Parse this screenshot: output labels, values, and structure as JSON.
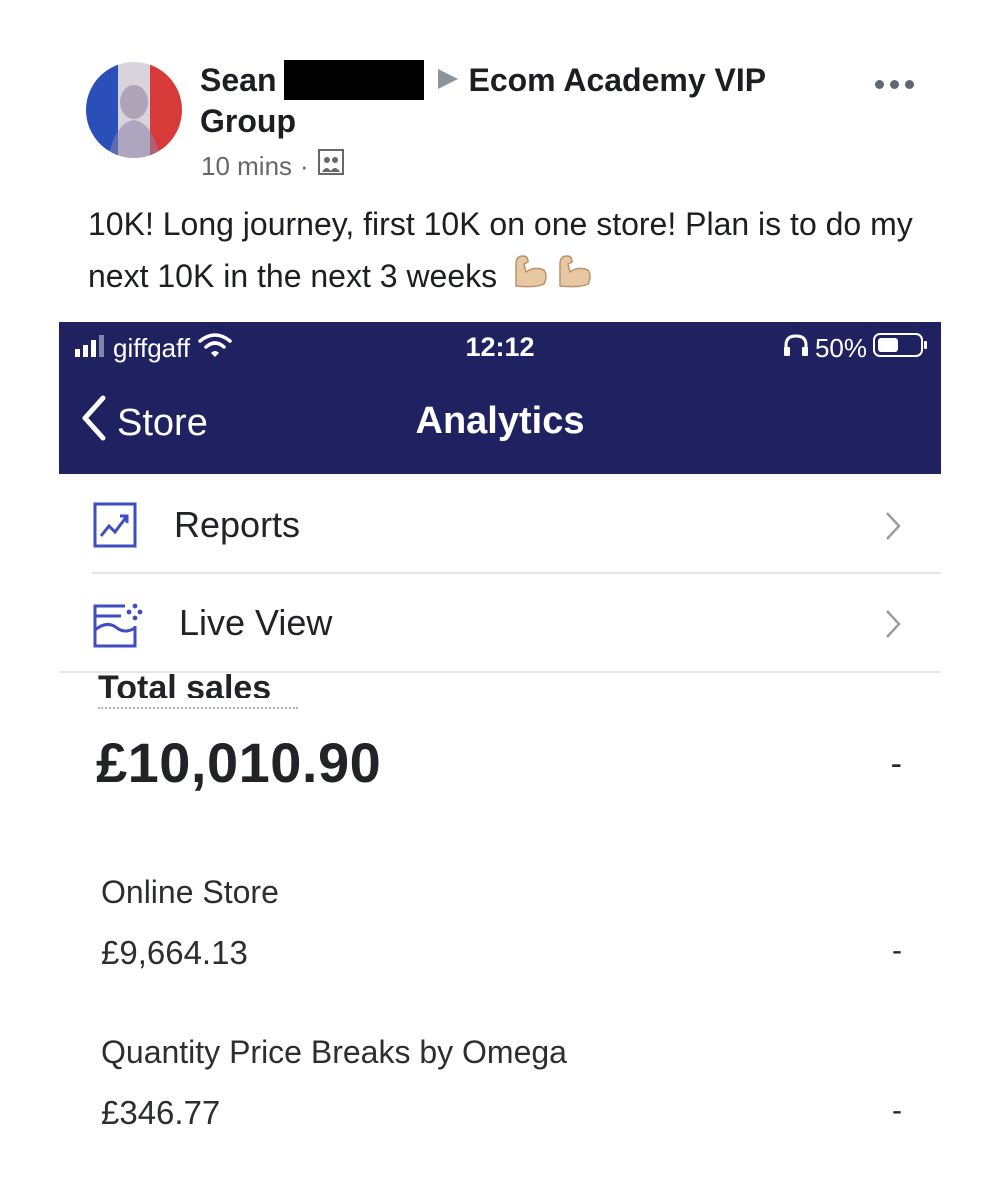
{
  "post": {
    "author_first": "Sean",
    "group_name_part1": "Ecom Academy VIP",
    "group_name_part2": "Group",
    "time": "10 mins",
    "separator": "·",
    "text": "10K! Long journey, first 10K on one store! Plan is to do my next 10K in the next 3 weeks"
  },
  "phone": {
    "status_bar": {
      "carrier": "giffgaff",
      "time": "12:12",
      "battery": "50%"
    },
    "nav": {
      "back_label": "Store",
      "title": "Analytics"
    },
    "menu": [
      {
        "label": "Reports",
        "icon": "reports-chart-icon"
      },
      {
        "label": "Live View",
        "icon": "live-view-icon"
      }
    ],
    "total_sales": {
      "label": "Total sales",
      "value": "£10,010.90",
      "change": "-"
    },
    "breakdown": [
      {
        "label": "Online Store",
        "value": "£9,664.13",
        "change": "-"
      },
      {
        "label": "Quantity Price Breaks by Omega",
        "value": "£346.77",
        "change": "-"
      }
    ]
  },
  "colors": {
    "navbar": "#1f2161",
    "accent_icon": "#3e4dbf",
    "meta_text": "#65676b"
  }
}
